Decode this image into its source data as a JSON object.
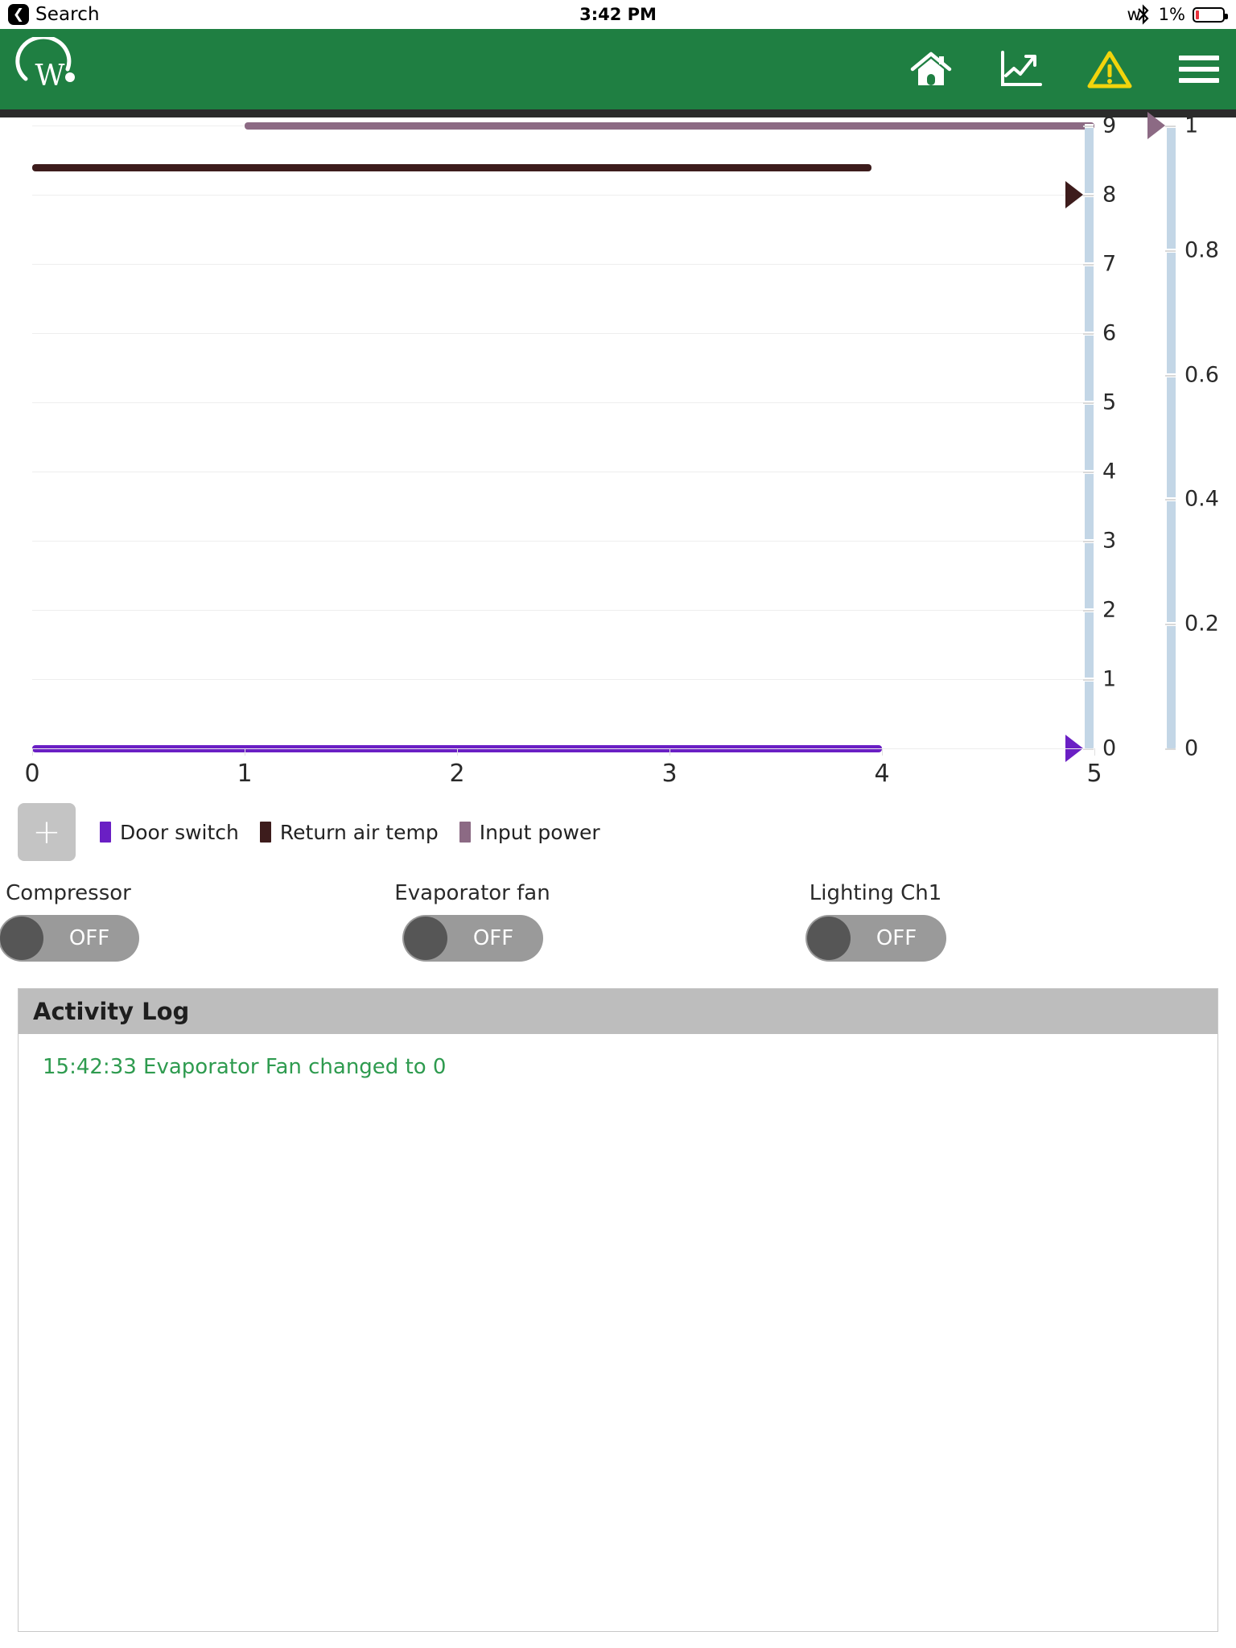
{
  "status_bar": {
    "back_label": "Search",
    "back_icon": "chevron-left-icon",
    "time": "3:42 PM",
    "bluetooth_icon": "bluetooth-icon",
    "battery_percent": "1%",
    "battery_icon": "battery-icon"
  },
  "app_bar": {
    "logo_name": "w-logo",
    "logo_letter": "W",
    "icons": [
      {
        "name": "home-icon",
        "label": "Home"
      },
      {
        "name": "trend-chart-icon",
        "label": "Trends"
      },
      {
        "name": "warning-triangle-icon",
        "label": "Alarms"
      },
      {
        "name": "hamburger-menu-icon",
        "label": "Menu"
      }
    ],
    "bar_color": "#1f7f42",
    "warning_color": "#f2d40c"
  },
  "chart_data": {
    "type": "line",
    "title": "",
    "xlabel": "",
    "ylabel": "",
    "x": [
      0,
      1,
      2,
      3,
      4,
      5
    ],
    "xlim": [
      0,
      5
    ],
    "x_tick_labels": [
      "0",
      "1",
      "2",
      "3",
      "4",
      "5"
    ],
    "grid": true,
    "legend_position": "bottom",
    "axes": [
      {
        "id": "axis-left-0-9",
        "color": "#c3d6e6",
        "lim": [
          0,
          9
        ],
        "tick_labels": [
          "0",
          "1",
          "2",
          "3",
          "4",
          "5",
          "6",
          "7",
          "8",
          "9"
        ],
        "markers": [
          {
            "series": "Return air temp",
            "value": 8,
            "color": "#3d1c1c"
          },
          {
            "series": "Door switch",
            "value": 0,
            "color": "#6a1fc4"
          }
        ]
      },
      {
        "id": "axis-right-0-1",
        "color": "#c3d6e6",
        "lim": [
          0,
          1
        ],
        "tick_labels": [
          "0",
          "0.2",
          "0.4",
          "0.6",
          "0.8",
          "1"
        ],
        "markers": [
          {
            "series": "Input power",
            "value": 1,
            "color": "#8c6a84"
          }
        ]
      }
    ],
    "series": [
      {
        "name": "Door switch",
        "color": "#6a1fc4",
        "axis": "axis-left-0-9",
        "value": 0,
        "x_start": 0,
        "x_end": 4
      },
      {
        "name": "Return air temp",
        "color": "#3d1c1c",
        "axis": "axis-left-0-9",
        "value": 8.4,
        "x_start": 0,
        "x_end": 3.95
      },
      {
        "name": "Input power",
        "color": "#8c6a84",
        "axis": "axis-right-0-1",
        "value": 1,
        "x_start": 1,
        "x_end": 5
      }
    ]
  },
  "legend": {
    "add_button_label": "+",
    "items": [
      {
        "label": "Door switch",
        "color": "#6a1fc4"
      },
      {
        "label": "Return air temp",
        "color": "#3d1c1c"
      },
      {
        "label": "Input power",
        "color": "#8c6a84"
      }
    ]
  },
  "controls": [
    {
      "label": "Compressor",
      "state": "OFF"
    },
    {
      "label": "Evaporator fan",
      "state": "OFF"
    },
    {
      "label": "Lighting Ch1",
      "state": "OFF"
    }
  ],
  "activity_log": {
    "title": "Activity Log",
    "entries": [
      {
        "text": "15:42:33 Evaporator Fan changed to 0",
        "color": "#2e9b4f"
      }
    ]
  }
}
